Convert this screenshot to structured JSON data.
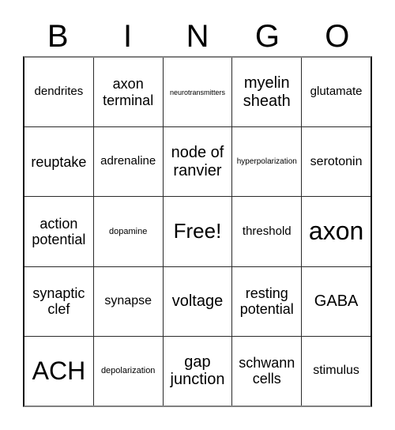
{
  "header": {
    "letters": [
      "B",
      "I",
      "N",
      "G",
      "O"
    ]
  },
  "grid": {
    "columns": 5,
    "rows": 5,
    "cells": [
      [
        {
          "label": "dendrites",
          "size": "m"
        },
        {
          "label": "axon terminal",
          "size": "l"
        },
        {
          "label": "neurotransmitters",
          "size": "xxs"
        },
        {
          "label": "myelin sheath",
          "size": "xl"
        },
        {
          "label": "glutamate",
          "size": "m"
        }
      ],
      [
        {
          "label": "reuptake",
          "size": "l"
        },
        {
          "label": "adrenaline",
          "size": "m"
        },
        {
          "label": "node of ranvier",
          "size": "xl"
        },
        {
          "label": "hyperpolarization",
          "size": "xs"
        },
        {
          "label": "serotonin",
          "size": "ml"
        }
      ],
      [
        {
          "label": "action potential",
          "size": "l"
        },
        {
          "label": "dopamine",
          "size": "s"
        },
        {
          "label": "Free!",
          "size": "xxl"
        },
        {
          "label": "threshold",
          "size": "m"
        },
        {
          "label": "axon",
          "size": "3xl"
        }
      ],
      [
        {
          "label": "synaptic clef",
          "size": "l"
        },
        {
          "label": "synapse",
          "size": "ml"
        },
        {
          "label": "voltage",
          "size": "xl"
        },
        {
          "label": "resting potential",
          "size": "l"
        },
        {
          "label": "GABA",
          "size": "xl"
        }
      ],
      [
        {
          "label": "ACH",
          "size": "3xl"
        },
        {
          "label": "depolarization",
          "size": "s"
        },
        {
          "label": "gap junction",
          "size": "xl"
        },
        {
          "label": "schwann cells",
          "size": "l"
        },
        {
          "label": "stimulus",
          "size": "ml"
        }
      ]
    ]
  },
  "colors": {
    "background": "#ffffff",
    "text": "#000000",
    "border": "#2b2b2b"
  }
}
